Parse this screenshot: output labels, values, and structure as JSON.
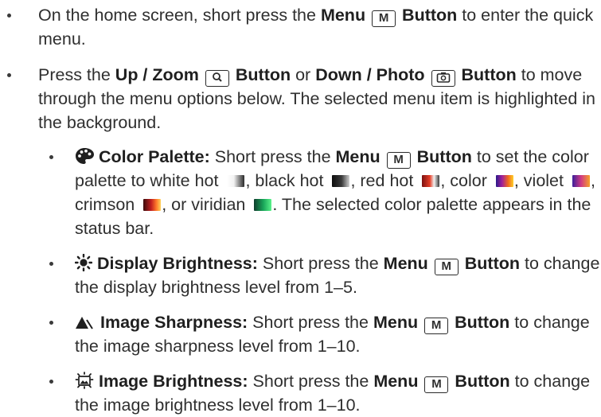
{
  "buttons": {
    "menu_key": "M"
  },
  "items": [
    {
      "pre": "On the home screen, short press the ",
      "b1": "Menu",
      "b2": "Button",
      "post": " to enter the quick menu."
    },
    {
      "pre": "Press the ",
      "b1": "Up / Zoom",
      "b2": "Button",
      "mid": " or ",
      "b3": "Down / Photo",
      "b4": "Button",
      "post": " to move through the menu options below. The selected menu item is highlighted in the background."
    }
  ],
  "sub_items": [
    {
      "icon": "palette-icon",
      "title": "Color Palette:",
      "pre": " Short press the ",
      "b1": "Menu",
      "b2": "Button",
      "t1": " to set the color palette to white hot ",
      "t2": ", black hot ",
      "t3": ", red hot ",
      "t4": ", color ",
      "t5": ", violet ",
      "t6": ", crimson ",
      "t7": ", or viridian ",
      "t8": ". The selected color palette appears in the status bar."
    },
    {
      "icon": "sun-icon",
      "title": "Display Brightness:",
      "pre": " Short press the ",
      "b1": "Menu",
      "b2": "Button",
      "post": " to change the display brightness level from 1–5."
    },
    {
      "icon": "sharpness-icon",
      "title": "Image Sharpness:",
      "pre": " Short press the ",
      "b1": "Menu",
      "b2": "Button",
      "post": " to change the image sharpness level from 1–10."
    },
    {
      "icon": "image-brightness-icon",
      "title": "Image Brightness:",
      "pre": " Short press the ",
      "b1": "Menu",
      "b2": "Button",
      "post": " to change the image brightness level from 1–10."
    }
  ],
  "colors": {
    "text": "#2f2f2f",
    "bold": "#1f1f1f"
  }
}
